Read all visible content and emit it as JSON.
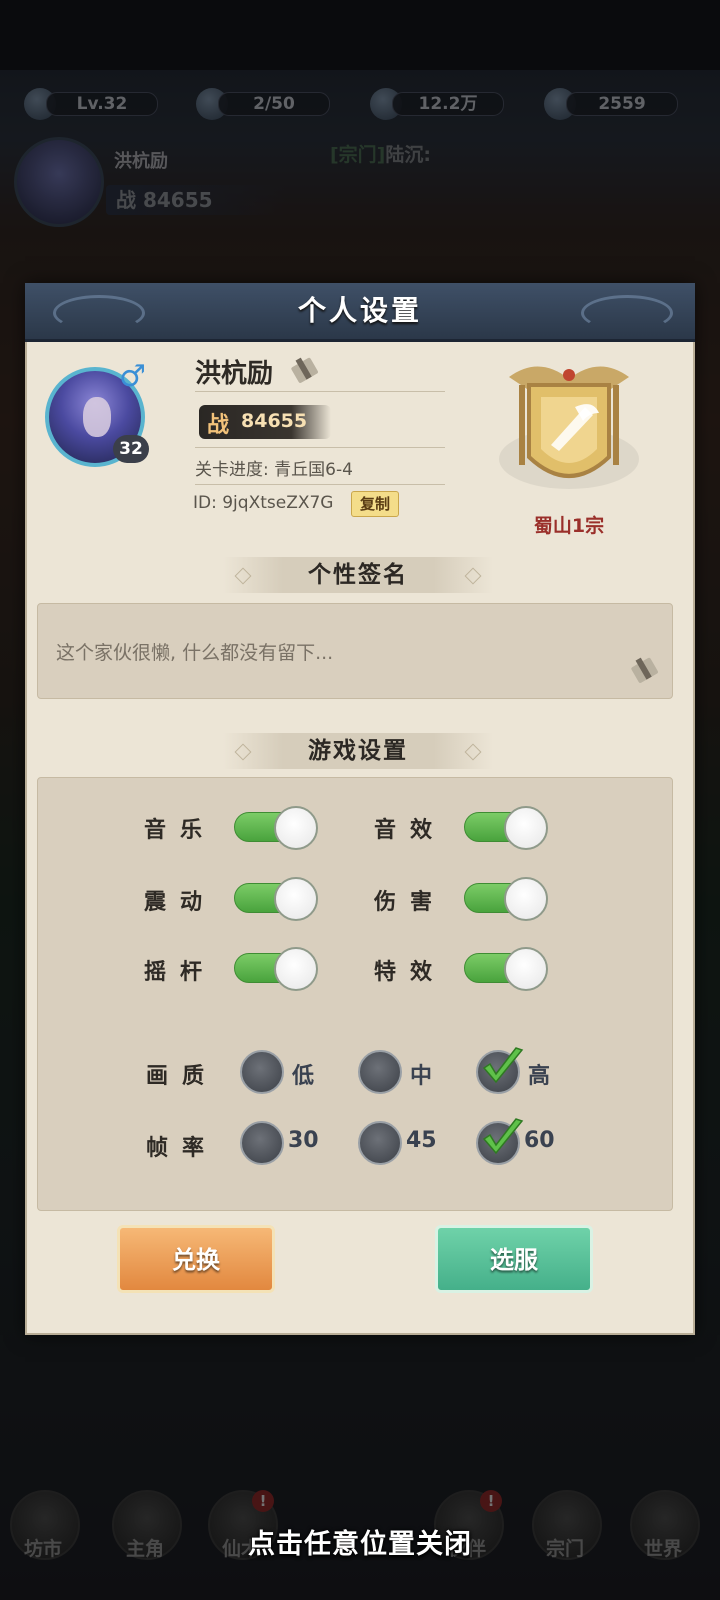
{
  "background": {
    "level": "Lv.32",
    "stamina": "2/50",
    "coins": "12.2万",
    "jade": "2559",
    "player_name": "洪杭励",
    "power_label": "战",
    "power_value": "84655",
    "chat_channel": "[宗门]",
    "chat_name": "陆沉:"
  },
  "bottom_nav": {
    "items": [
      {
        "label": "坊市"
      },
      {
        "label": "主角"
      },
      {
        "label": "仙术"
      },
      {
        "label": "伙伴"
      },
      {
        "label": "宗门"
      },
      {
        "label": "世界"
      }
    ],
    "badge_text": "!"
  },
  "dialog": {
    "title": "个人设置",
    "player": {
      "name": "洪杭励",
      "gender_symbol": "♂",
      "level": "32",
      "power_label": "战",
      "power_value": "84655",
      "stage_progress_label": "关卡进度:",
      "stage_progress_value": "青丘国6-4",
      "id_text": "ID: 9jqXtseZX7G",
      "copy_label": "复制"
    },
    "sect": {
      "name": "蜀山1宗"
    },
    "signature": {
      "section_title": "个性签名",
      "text": "这个家伙很懒, 什么都没有留下..."
    },
    "game_settings": {
      "section_title": "游戏设置",
      "toggles": [
        {
          "label": "音乐",
          "on": true
        },
        {
          "label": "音效",
          "on": true
        },
        {
          "label": "震动",
          "on": true
        },
        {
          "label": "伤害",
          "on": true
        },
        {
          "label": "摇杆",
          "on": true
        },
        {
          "label": "特效",
          "on": true
        }
      ],
      "quality": {
        "label": "画质",
        "options": [
          "低",
          "中",
          "高"
        ],
        "selected": "高"
      },
      "framerate": {
        "label": "帧率",
        "options": [
          "30",
          "45",
          "60"
        ],
        "selected": "60"
      }
    },
    "buttons": {
      "exchange": "兑换",
      "outfit": "选服"
    }
  },
  "close_hint": "点击任意位置关闭",
  "colors": {
    "panel": "#ece5d6",
    "header": "#3f5067",
    "toggle_on": "#5cb64a",
    "accent_red": "#9a2f2a",
    "exchange_button": "#e99c52",
    "outfit_button": "#58c29a"
  }
}
